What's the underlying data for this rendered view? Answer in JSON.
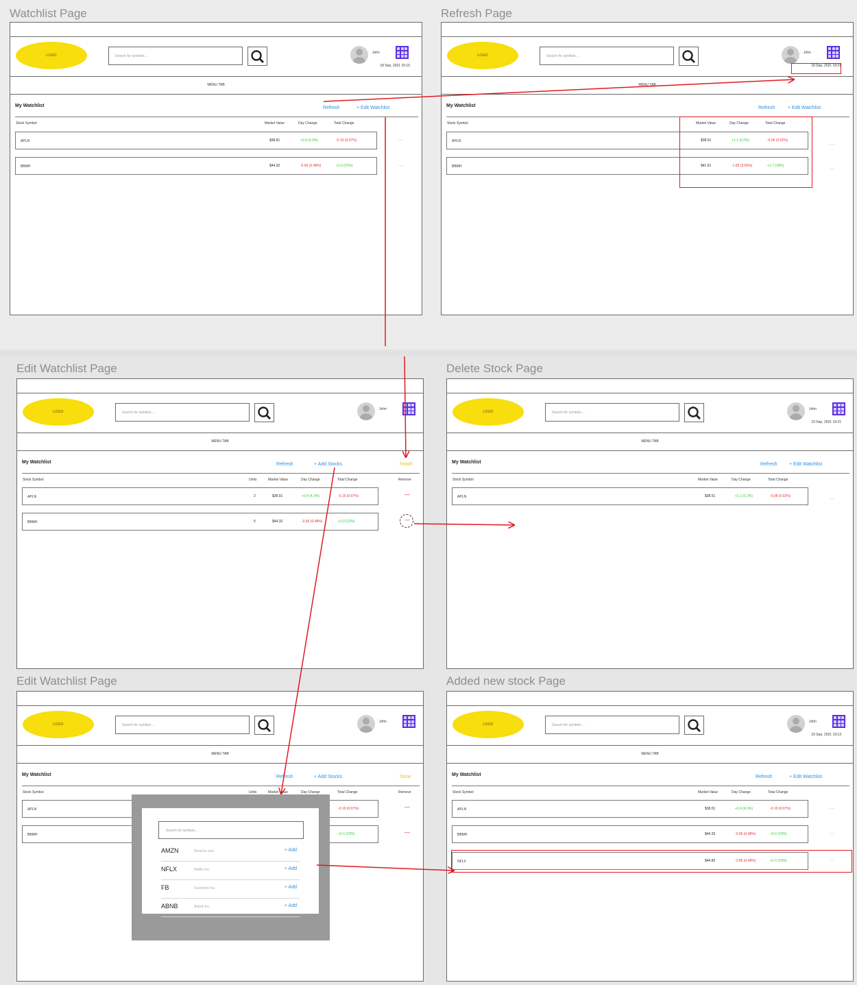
{
  "pages": [
    {
      "title": "Watchlist Page",
      "header": {
        "logo": "LOGO",
        "search_placeholder": "Search for symbols ...",
        "username": "John",
        "timestamp": "18 Sep, 2021 15:15"
      },
      "menu_tab": "MENU TAB",
      "watchlist_title": "My Watchlist",
      "actions": [
        "Refresh",
        "+ Edit Watchlist"
      ],
      "columns": {
        "symbol": "Stock Symbol",
        "market_value": "Market Value",
        "day_change": "Day Change",
        "total_change": "Total Change"
      },
      "rows": [
        {
          "symbol": "APLN",
          "market_value": "$38.81",
          "day_change": "+0.4 (4.3%)",
          "total_change": "-0.19 (0.07%)",
          "more": "..."
        },
        {
          "symbol": "BBMH",
          "market_value": "$44.32",
          "day_change": "-0.66 (0.48%)",
          "total_change": "+2.0 (23%)",
          "more": "..."
        }
      ]
    },
    {
      "title": "Refresh Page",
      "header": {
        "logo": "LOGO",
        "search_placeholder": "Search for symbols ...",
        "username": "John",
        "timestamp": "18 Sep, 2021 19:21"
      },
      "menu_tab": "MENU TAB",
      "watchlist_title": "My Watchlist",
      "actions": [
        "Refresh",
        "+ Edit Watchlist"
      ],
      "columns": {
        "symbol": "Stock Symbol",
        "market_value": "Market Value",
        "day_change": "Day Change",
        "total_change": "Total Change"
      },
      "rows": [
        {
          "symbol": "APLN",
          "market_value": "$38.51",
          "day_change": "+1.1 (0.2%)",
          "total_change": "-0.06 (0.02%)",
          "more": "..."
        },
        {
          "symbol": "BBMH",
          "market_value": "$41.61",
          "day_change": "-1.83 (3.50%)",
          "total_change": "+1.7 (18%)",
          "more": "..."
        }
      ]
    },
    {
      "title": "Edit Watchlist Page",
      "header": {
        "logo": "LOGO",
        "search_placeholder": "Search for symbols ...",
        "username": "John"
      },
      "menu_tab": "MENU TAB",
      "watchlist_title": "My Watchlist",
      "actions": [
        "Refresh",
        "+ Add Stocks",
        "Finish"
      ],
      "columns": {
        "symbol": "Stock Symbol",
        "units": "Units",
        "market_value": "Market Value",
        "day_change": "Day Change",
        "total_change": "Total Change",
        "remove": "Remove"
      },
      "rows": [
        {
          "symbol": "APLN",
          "units": "2",
          "market_value": "$38.01",
          "day_change": "+0.4 (4.3%)",
          "total_change": "-0.19 (0.07%)",
          "remove": "—"
        },
        {
          "symbol": "BBMH",
          "units": "5",
          "market_value": "$44.32",
          "day_change": "-0.66 (0.48%)",
          "total_change": "+2.0 (23%)",
          "remove": "—"
        }
      ]
    },
    {
      "title": "Delete Stock Page",
      "header": {
        "logo": "LOGO",
        "search_placeholder": "Search for symbols ...",
        "username": "John",
        "timestamp": "19 Sep, 2021 19:21"
      },
      "menu_tab": "MENU TAB",
      "watchlist_title": "My Watchlist",
      "actions": [
        "Refresh",
        "+ Edit Watchlist"
      ],
      "columns": {
        "symbol": "Stock Symbol",
        "market_value": "Market Value",
        "day_change": "Day Change",
        "total_change": "Total Change"
      },
      "rows": [
        {
          "symbol": "APLN",
          "market_value": "$38.51",
          "day_change": "+1.1 (0.2%)",
          "total_change": "-0.08 (0.02%)",
          "more": "..."
        }
      ]
    },
    {
      "title": "Edit Watchlist Page",
      "header": {
        "logo": "LOGO",
        "search_placeholder": "Search for symbols ...",
        "username": "John"
      },
      "menu_tab": "MENU TAB",
      "watchlist_title": "My Watchlist",
      "actions": [
        "Refresh",
        "+ Add Stocks",
        "Done"
      ],
      "columns": {
        "symbol": "Stock Symbol",
        "units": "Units",
        "market_value": "Market Value",
        "day_change": "Day Change",
        "total_change": "Total Change",
        "remove": "Remove"
      },
      "rows": [
        {
          "symbol": "APLN",
          "total_change": "-0.19 (0.07%)",
          "remove": "—"
        },
        {
          "symbol": "BBMH",
          "total_change": "+2.0 (23%)",
          "remove": "—"
        }
      ],
      "add_dialog": {
        "search_placeholder": "Search for symbols ...",
        "suggestions": [
          {
            "symbol": "AMZN",
            "name": "Amazon.com",
            "add": "+ Add"
          },
          {
            "symbol": "NFLX",
            "name": "Netflix Inc.",
            "add": "+ Add"
          },
          {
            "symbol": "FB",
            "name": "Facebook Inc.",
            "add": "+ Add"
          },
          {
            "symbol": "ABNB",
            "name": "Airbnb Inc.",
            "add": "+ Add"
          }
        ]
      }
    },
    {
      "title": "Added new stock Page",
      "header": {
        "logo": "LOGO",
        "search_placeholder": "Search for symbols ...",
        "username": "John",
        "timestamp": "19 Sep, 2021 19:13"
      },
      "menu_tab": "MENU TAB",
      "watchlist_title": "My Watchlist",
      "actions": [
        "Refresh",
        "+ Edit Watchlist"
      ],
      "columns": {
        "symbol": "Stock Symbol",
        "market_value": "Market Value",
        "day_change": "Day Change",
        "total_change": "Total Change"
      },
      "rows": [
        {
          "symbol": "APLN",
          "market_value": "$38.01",
          "day_change": "+0.4 (4.3%)",
          "total_change": "-0.19 (0.07%)",
          "more": "..."
        },
        {
          "symbol": "BBMH",
          "market_value": "$44.33",
          "day_change": "-0.66 (0.48%)",
          "total_change": "+0.0 (23%)",
          "more": "..."
        },
        {
          "symbol": "NFLX",
          "market_value": "$44.82",
          "day_change": "-2.86 (0.48%)",
          "total_change": "+2.0 (23%)",
          "more": "..."
        }
      ]
    }
  ],
  "colors": {
    "logo": "#f7de0c",
    "link": "#2e8fe0",
    "positive": "#35c93b",
    "negative": "#e23232",
    "annotation_arrow": "#e0191e",
    "apps_icon": "#5b2ee0",
    "finish": "#e0c21a"
  }
}
